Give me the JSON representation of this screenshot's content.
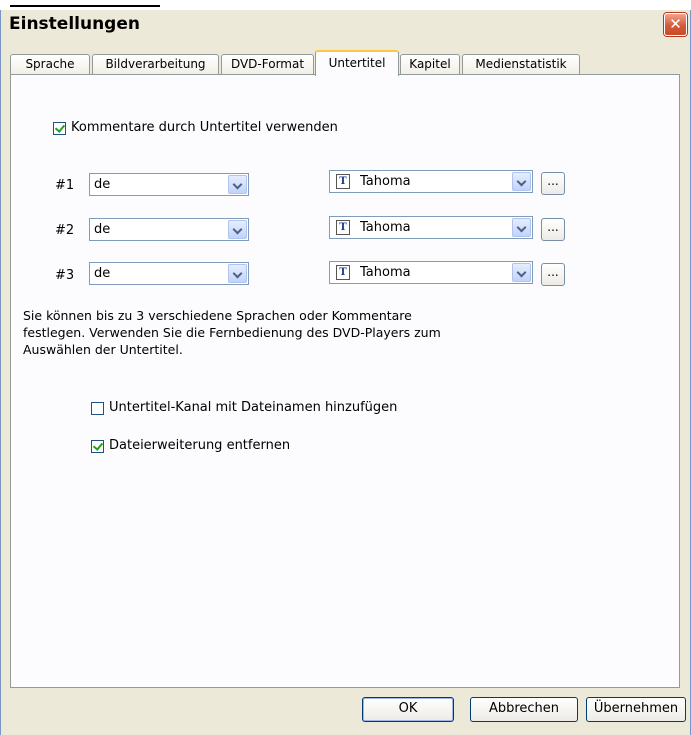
{
  "window": {
    "title": "Einstellungen",
    "close_glyph": "✕"
  },
  "tabs": [
    {
      "label": "Sprache"
    },
    {
      "label": "Bildverarbeitung"
    },
    {
      "label": "DVD-Format"
    },
    {
      "label": "Untertitel",
      "active": true
    },
    {
      "label": "Kapitel"
    },
    {
      "label": "Medienstatistik"
    }
  ],
  "panel": {
    "use_comments_checkbox": {
      "label": "Kommentare durch Untertitel verwenden",
      "checked": true
    },
    "rows": [
      {
        "label": "#1",
        "language": "de",
        "font": "Tahoma",
        "more": "..."
      },
      {
        "label": "#2",
        "language": "de",
        "font": "Tahoma",
        "more": "..."
      },
      {
        "label": "#3",
        "language": "de",
        "font": "Tahoma",
        "more": "..."
      }
    ],
    "info_lines": [
      "Sie können bis zu 3 verschiedene Sprachen oder Kommentare",
      "festlegen. Verwenden Sie die Fernbedienung des DVD-Players zum",
      "Auswählen der Untertitel."
    ],
    "add_channel_checkbox": {
      "label": "Untertitel-Kanal mit Dateinamen hinzufügen",
      "checked": false
    },
    "remove_extension_checkbox": {
      "label": "Dateierweiterung entfernen",
      "checked": true
    }
  },
  "buttons": {
    "ok": "OK",
    "cancel": "Abbrechen",
    "apply": "Übernehmen"
  },
  "icons": {
    "font_icon_glyph": "T",
    "close": "close-icon",
    "dropdown": "chevron-down-icon",
    "font": "truetype-font-icon",
    "checkbox": "checkmark-icon"
  },
  "colors": {
    "dialog_bg": "#ece9d8",
    "panel_bg": "#fcfcfe",
    "active_tab_accent": "#ffc83c",
    "close_button": "#d45c3b",
    "check_color": "#21a121"
  }
}
